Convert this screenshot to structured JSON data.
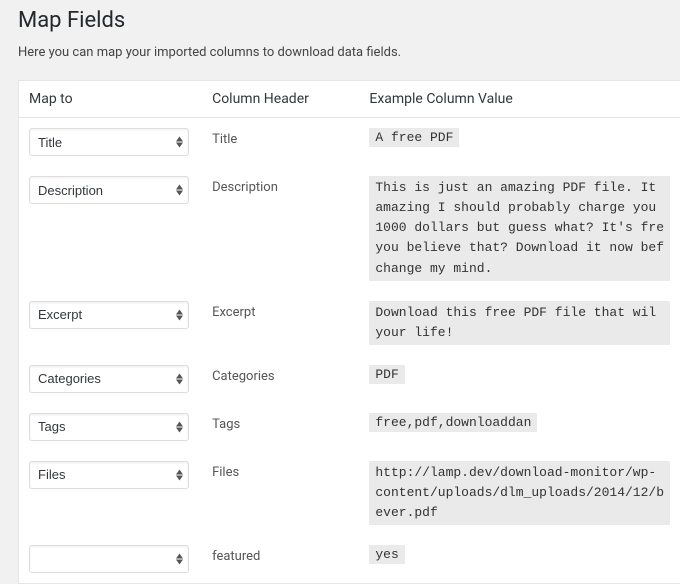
{
  "page": {
    "title": "Map Fields",
    "description": "Here you can map your imported columns to download data fields."
  },
  "headers": {
    "mapto": "Map to",
    "column_header": "Column Header",
    "example": "Example Column Value"
  },
  "rows": [
    {
      "select": "Title",
      "header": "Title",
      "example": "A free PDF"
    },
    {
      "select": "Description",
      "header": "Description",
      "example": "This is just an amazing PDF file. It amazing I should probably charge you 1000 dollars but guess what? It's fre you believe that? Download it now bef change my mind."
    },
    {
      "select": "Excerpt",
      "header": "Excerpt",
      "example": "Download this free PDF file that wil your life!"
    },
    {
      "select": "Categories",
      "header": "Categories",
      "example": "PDF"
    },
    {
      "select": "Tags",
      "header": "Tags",
      "example": "free,pdf,downloaddan"
    },
    {
      "select": "Files",
      "header": "Files",
      "example": "http://lamp.dev/download-monitor/wp-content/uploads/dlm_uploads/2014/12/b ever.pdf"
    },
    {
      "select": "",
      "header": "featured",
      "example": "yes"
    }
  ]
}
